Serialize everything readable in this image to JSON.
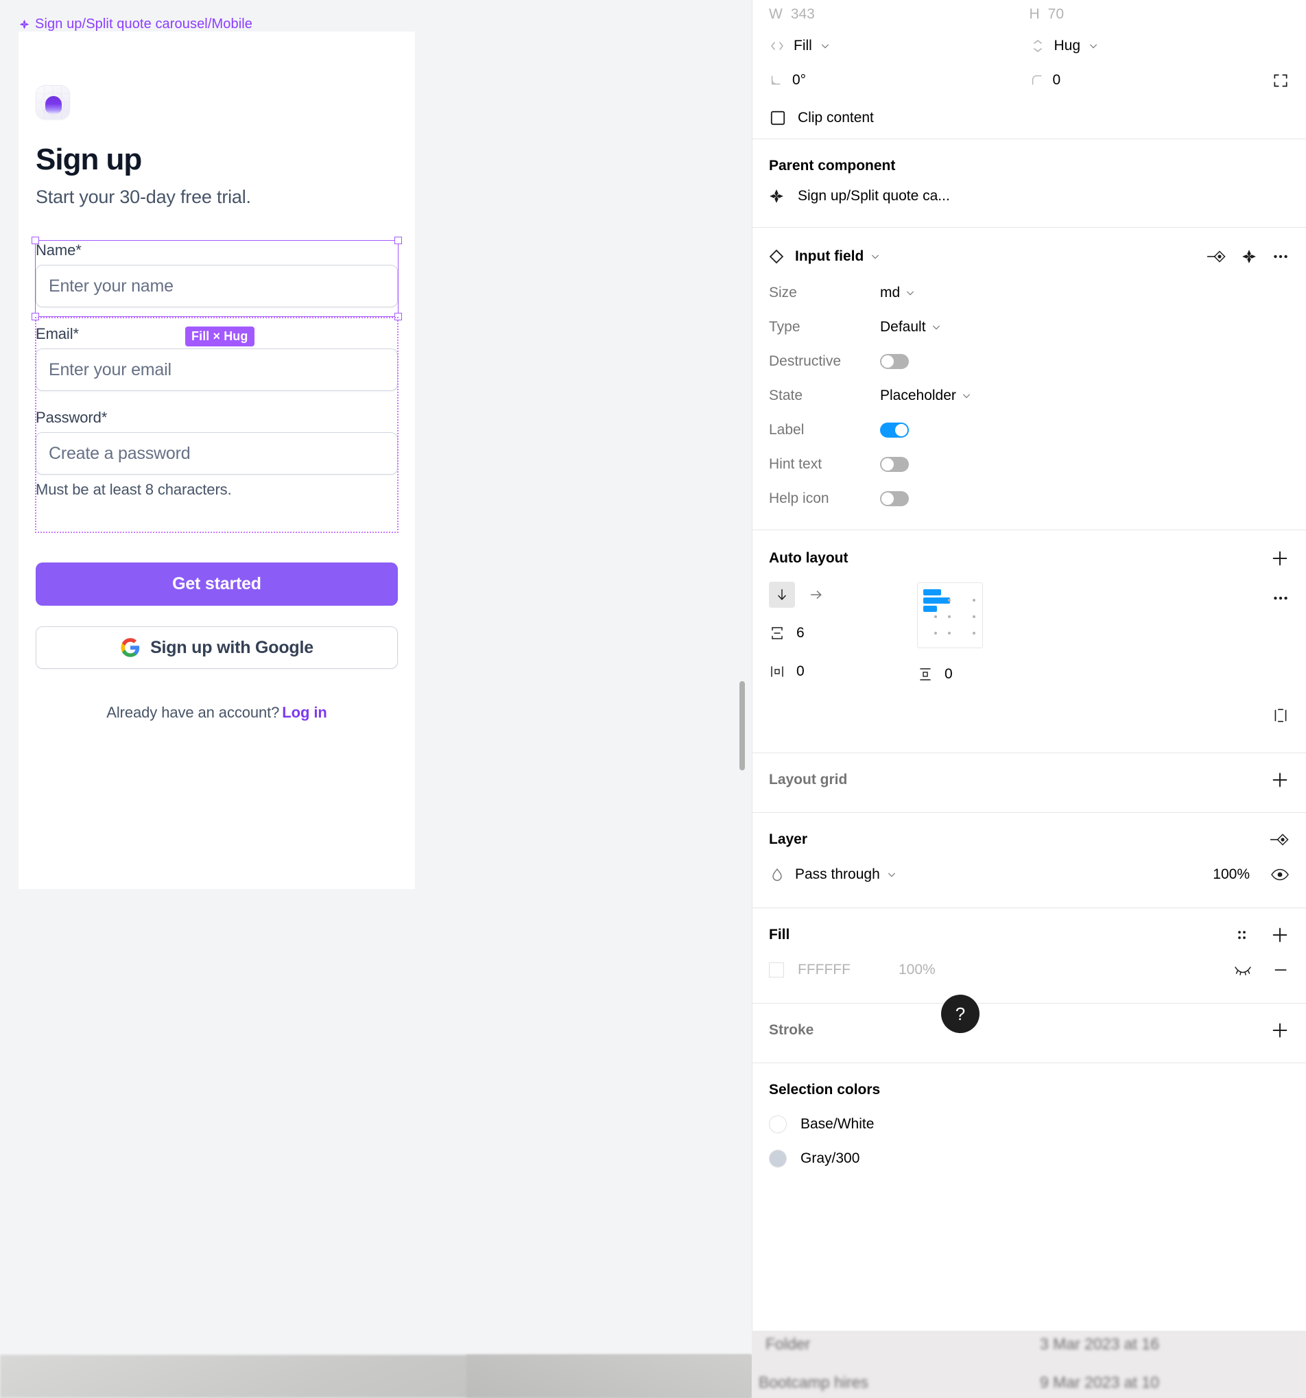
{
  "canvas": {
    "frame_label": "Sign up/Split quote carousel/Mobile",
    "selection_badge": "Fill × Hug"
  },
  "signup": {
    "title": "Sign up",
    "subtitle": "Start your 30-day free trial.",
    "fields": [
      {
        "label": "Name*",
        "placeholder": "Enter your name"
      },
      {
        "label": "Email*",
        "placeholder": "Enter your email"
      },
      {
        "label": "Password*",
        "placeholder": "Create a password",
        "hint": "Must be at least 8 characters."
      }
    ],
    "primary_button": "Get started",
    "google_button": "Sign up with Google",
    "footer_text": "Already have an account?",
    "footer_link": "Log in"
  },
  "panel": {
    "dimensions": {
      "w_label": "W",
      "w_value": "343",
      "h_label": "H",
      "h_value": "70"
    },
    "resizing": {
      "horizontal": "Fill",
      "vertical": "Hug"
    },
    "rotation": "0°",
    "corner_radius": "0",
    "clip_content": "Clip content",
    "parent_component": {
      "title": "Parent component",
      "name": "Sign up/Split quote ca..."
    },
    "component": {
      "name": "Input field",
      "props": [
        {
          "key": "Size",
          "type": "select",
          "value": "md"
        },
        {
          "key": "Type",
          "type": "select",
          "value": "Default"
        },
        {
          "key": "Destructive",
          "type": "toggle",
          "value": "off"
        },
        {
          "key": "State",
          "type": "select",
          "value": "Placeholder"
        },
        {
          "key": "Label",
          "type": "toggle",
          "value": "on"
        },
        {
          "key": "Hint text",
          "type": "toggle",
          "value": "off"
        },
        {
          "key": "Help icon",
          "type": "toggle",
          "value": "off"
        }
      ]
    },
    "auto_layout": {
      "title": "Auto layout",
      "direction": "vertical",
      "gap": "6",
      "padding_horizontal": "0",
      "padding_vertical": "0"
    },
    "layout_grid": {
      "title": "Layout grid"
    },
    "layer": {
      "title": "Layer",
      "blend_mode": "Pass through",
      "opacity": "100%"
    },
    "fill": {
      "title": "Fill",
      "color": "FFFFFF",
      "opacity": "100%"
    },
    "stroke": {
      "title": "Stroke"
    },
    "selection_colors": {
      "title": "Selection colors",
      "items": [
        {
          "name": "Base/White",
          "hex": "#FFFFFF"
        },
        {
          "name": "Gray/300",
          "hex": "#CBD2DC"
        }
      ]
    },
    "help_button": "?"
  },
  "background": {
    "rows": [
      "Folder",
      "3 Mar 2023 at 16",
      "Bootcamp  hires",
      "9 Mar 2023 at 10"
    ]
  },
  "colors": {
    "accent_purple": "#8b5cf6",
    "figma_selection": "#a259ff",
    "toggle_on": "#0d99ff",
    "link": "#7c3aed"
  }
}
